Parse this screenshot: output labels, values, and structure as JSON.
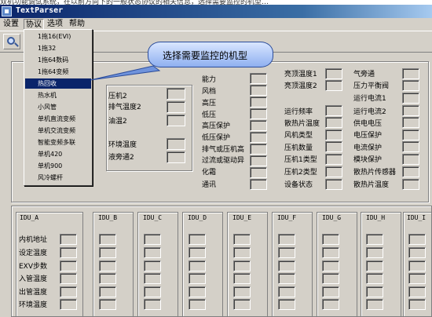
{
  "top_cut_text": "双机功能调试系统，在以前方向下的一般状态协议的相关信息，选择需要监控的机型…",
  "window": {
    "title": "TextParser"
  },
  "menubar": [
    "设置",
    "协议",
    "选项",
    "帮助"
  ],
  "toolbar": {
    "zoom_icon": "magnifier-icon"
  },
  "protocol_menu": {
    "items": [
      "1拖16(EVI)",
      "1拖32",
      "1拖64数码",
      "1拖64变频",
      "热回收",
      "热水机",
      "小风管",
      "单机直流变频",
      "单机交流变频",
      "智能变频多联",
      "单机420",
      "单机900",
      "风冷螺杆"
    ],
    "highlighted_index": 4
  },
  "callout": {
    "text": "选择需要监控的机型"
  },
  "fields": {
    "col_a": [
      "压机2",
      "排气温度2",
      "油温2",
      "环境温度",
      "液旁通2"
    ],
    "col_b": [
      "能力",
      "风档",
      "高压",
      "低压",
      "高压保护",
      "低压保护",
      "排气或压机高",
      "过流或驱动异",
      "化霜",
      "通讯"
    ],
    "col_c1": [
      "亮顶温度1",
      "亮顶温度2"
    ],
    "col_c2": [
      "运行频率",
      "散热片温度",
      "风机类型",
      "压机数量",
      "压机1类型",
      "压机2类型",
      "设备状态"
    ],
    "col_d1": [
      "气旁通",
      "压力平衡阀",
      "运行电流1"
    ],
    "col_d2": [
      "运行电流2",
      "供电电压",
      "电压保护",
      "电流保护",
      "模块保护",
      "散热片传感器",
      "散热片温度"
    ]
  },
  "idu": {
    "headers": [
      "IDU_A",
      "IDU_B",
      "IDU_C",
      "IDU_D",
      "IDU_E",
      "IDU_F",
      "IDU_G",
      "IDU_H",
      "IDU_I"
    ],
    "row_labels": [
      "内机地址",
      "设定温度",
      "EXV步数",
      "入管温度",
      "出管温度",
      "环境温度"
    ]
  }
}
